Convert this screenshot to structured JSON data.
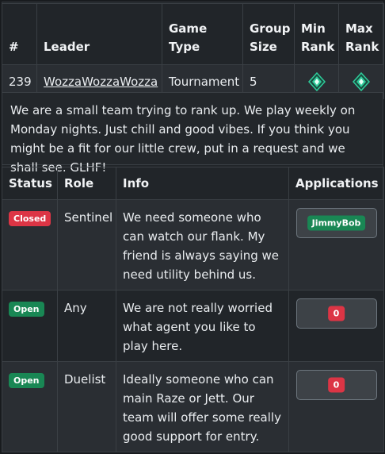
{
  "group": {
    "headers": {
      "number": "#",
      "leader": "Leader",
      "game_type": "Game Type",
      "group_size": "Group Size",
      "min_rank": "Min Rank",
      "max_rank": "Max Rank"
    },
    "row": {
      "number": "239",
      "leader": "WozzaWozzaWozza",
      "game_type": "Tournament",
      "group_size": "5",
      "min_rank_icon": "rank-emblem-icon",
      "max_rank_icon": "rank-emblem-icon"
    },
    "description": "We are a small team trying to rank up. We play weekly on Monday nights. Just chill and good vibes. If you think you might be a fit for our little crew, put in a request and we shall see. GLHF!"
  },
  "roles": {
    "headers": {
      "status": "Status",
      "role": "Role",
      "info": "Info",
      "applications": "Applications"
    },
    "rows": [
      {
        "status": "Closed",
        "role": "Sentinel",
        "info": "We need someone who can watch our flank. My friend is always saying we need utility behind us.",
        "application": "JimmyBob"
      },
      {
        "status": "Open",
        "role": "Any",
        "info": "We are not really worried what agent you like to play here.",
        "application": "0"
      },
      {
        "status": "Open",
        "role": "Duelist",
        "info": "Ideally someone who can main Raze or Jett. Our team will offer some really good support for entry.",
        "application": "0"
      }
    ]
  },
  "colors": {
    "page_bg": "#212529",
    "closed": "#dc3545",
    "open": "#198754",
    "rank_icon": "#2ecc9a"
  }
}
